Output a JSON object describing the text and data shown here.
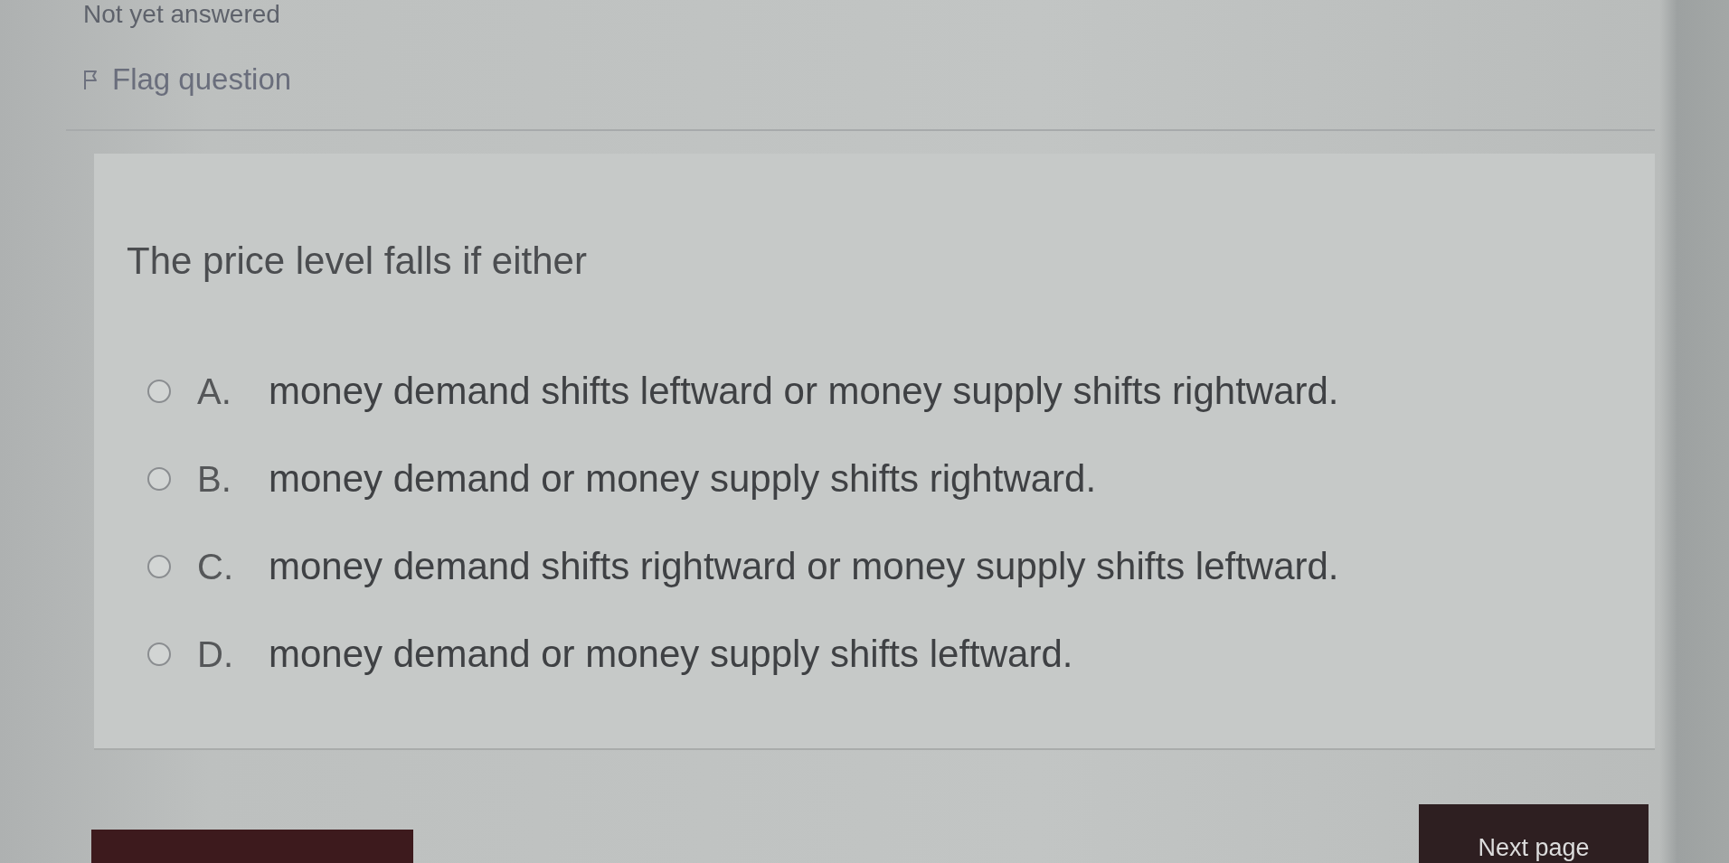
{
  "status": {
    "text": "Not yet answered"
  },
  "flag": {
    "label": "Flag question"
  },
  "question": {
    "text": "The price level falls if either",
    "options": [
      {
        "letter": "A.",
        "text": "money demand shifts leftward or money supply shifts rightward.",
        "selected": false
      },
      {
        "letter": "B.",
        "text": "money demand or money supply shifts rightward.",
        "selected": false
      },
      {
        "letter": "C.",
        "text": "money demand shifts rightward or money supply shifts leftward.",
        "selected": false
      },
      {
        "letter": "D.",
        "text": "money demand or money supply shifts leftward.",
        "selected": false
      }
    ]
  },
  "nav_buttons": [
    {
      "kind": "plain"
    },
    {
      "kind": "labeled",
      "label": "Next page"
    }
  ]
}
